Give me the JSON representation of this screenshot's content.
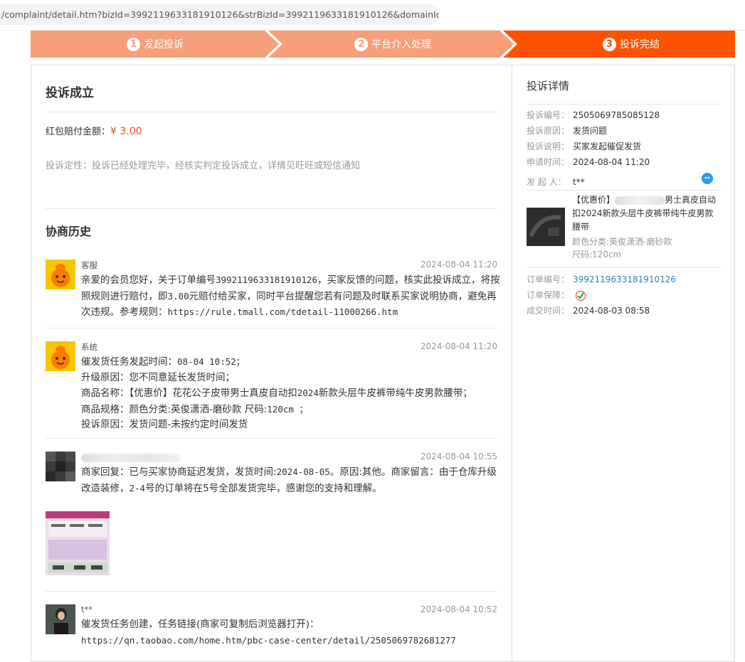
{
  "browser": {
    "url": "/complaint/detail.htm?bizId=3992119633181910126&strBizId=3992119633181910126&domainId..."
  },
  "steps": [
    {
      "num": "1",
      "label": "发起投诉"
    },
    {
      "num": "2",
      "label": "平台介入处理"
    },
    {
      "num": "3",
      "label": "投诉完结"
    }
  ],
  "colors": {
    "step_done": "#f89f7a",
    "step_active": "#ff5200",
    "amount": "#e4532a",
    "link": "#2e7fbf"
  },
  "main": {
    "title": "投诉成立",
    "amount_label": "红包赔付金额：",
    "amount_value": "¥ 3.00",
    "verdict": "投诉定性：投诉已经处理完毕，经核实判定投诉成立，详情见旺旺或短信通知",
    "history_title": "协商历史",
    "messages": [
      {
        "author": "客服",
        "time": "2024-08-04 11:20",
        "text_parts": {
          "p1": "亲爱的会员您好，关于订单编号",
          "order": "3992119633181910126",
          "p2": "，买家反馈的问题，核实此投诉成立，将按照规则进行赔付，即",
          "amt": "3.00",
          "p3": "元赔付给买家，同时平台提醒您若有问题及时联系买家说明协商，避免再次违规。参考规则：",
          "url": "https://rule.tmall.com/tdetail-11000266.htm"
        }
      },
      {
        "author": "系统",
        "time": "2024-08-04 11:20",
        "line1_label": "催发货任务发起时间：",
        "line1_val": "08-04 10:52；",
        "line2": "升级原因：您不同意延长发货时间；",
        "line3_a": "商品名称：【优惠价】花花公子皮带男士真皮自动扣",
        "line3_num": "2024",
        "line3_b": "新款头层牛皮裤带纯牛皮男款腰带；",
        "line4_a": "商品规格：颜色分类:英俊潇洒-磨砂款 尺码:",
        "line4_num": "120cm ；",
        "line5": "投诉原因：发货问题-未按约定时间发货"
      },
      {
        "author": "",
        "time": "2024-08-04 10:55",
        "p1": "商家回复：已与买家协商延迟发货，发货时间:",
        "date": "2024-08-05",
        "p2": "。原因:其他。商家留言：由于仓库升级改造装修，",
        "r1": "2-4",
        "p3": "号的订单将在5号全部发货完毕，感谢您的支持和理解。"
      },
      {
        "author": "t**",
        "time": "2024-08-04 10:52",
        "p1": "催发货任务创建，任务链接(商家可复制后浏览器打开)：",
        "url": "https://qn.taobao.com/home.htm/pbc-case-center/detail/2505069782681277"
      }
    ]
  },
  "side": {
    "title": "投诉详情",
    "rows": [
      {
        "k": "投诉编号：",
        "v": "2505069785085128"
      },
      {
        "k": "投诉原因：",
        "v": "发货问题"
      },
      {
        "k": "投诉说明：",
        "v": "买家发起催促发货"
      },
      {
        "k": "申请时间：",
        "v": "2024-08-04 11:20"
      },
      {
        "k": "发 起 人：",
        "v": "t**"
      }
    ],
    "product": {
      "title_prefix": "【优惠价】",
      "title_rest": "男士真皮自动扣2024新款头层牛皮裤带纯牛皮男款腰带",
      "sku1": "颜色分类:英俊潇洒-磨砂款",
      "sku2": "尺码:120cm"
    },
    "order_rows": [
      {
        "k": "订单编号：",
        "v": "3992119633181910126"
      },
      {
        "k": "订单保障：",
        "v": ""
      },
      {
        "k": "成交时间：",
        "v": "2024-08-03 08:58"
      }
    ]
  }
}
